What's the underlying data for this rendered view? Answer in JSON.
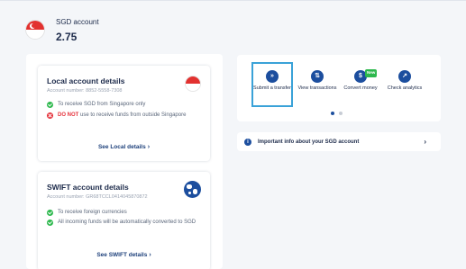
{
  "header": {
    "account_title": "SGD account",
    "balance": "2.75"
  },
  "local_card": {
    "title": "Local account details",
    "account_number": "Account number: 8852-5558-7308",
    "bullet_1": "To receive SGD from Singapore only",
    "bullet_2_not": "DO NOT",
    "bullet_2_rest": " use to receive funds from outside Singapore",
    "link": "See Local details",
    "chevron": "›"
  },
  "swift_card": {
    "title": "SWIFT account details",
    "account_number": "Account number: GR68TCCL0414045870872",
    "bullet_1": "To receive foreign currencies",
    "bullet_2": "All incoming funds will be automatically converted to SGD",
    "link": "See SWIFT details",
    "chevron": "›"
  },
  "actions": {
    "submit": {
      "label": "Submit a transfer",
      "icon": "»"
    },
    "view": {
      "label": "View transactions",
      "icon": "⇅"
    },
    "convert": {
      "label": "Convert money",
      "icon": "$",
      "badge": "New"
    },
    "check": {
      "label": "Check analytics",
      "icon": "↗"
    }
  },
  "info": {
    "icon": "i",
    "text": "Important info about your SGD account",
    "chevron": "›"
  },
  "colors": {
    "brand_blue": "#1c4e9e",
    "success_green": "#2db84d",
    "danger_red": "#e5323b",
    "selected_outline": "#3aa2d8"
  }
}
